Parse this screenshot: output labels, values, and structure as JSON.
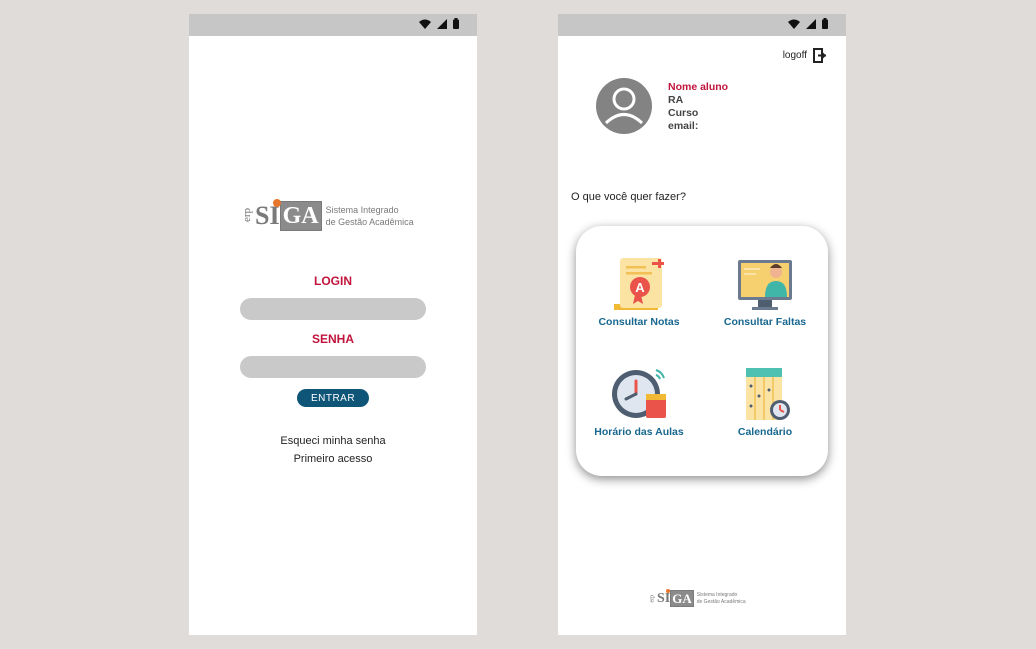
{
  "login_screen": {
    "logo": {
      "erp": "erp",
      "si": "SI",
      "ga": "GA",
      "tagline_line1": "Sistema Integrado",
      "tagline_line2": "de Gestão Acadêmica"
    },
    "login_label": "LOGIN",
    "login_value": "",
    "senha_label": "SENHA",
    "senha_value": "",
    "entrar_label": "ENTRAR",
    "forgot_password": "Esqueci minha senha",
    "first_access": "Primeiro acesso"
  },
  "home_screen": {
    "logoff_label": "logoff",
    "profile": {
      "name": "Nome aluno",
      "ra": "RA",
      "curso": "Curso",
      "email": "email:"
    },
    "question": "O que você quer fazer?",
    "menu": [
      {
        "label": "Consultar Notas",
        "icon": "grades-icon"
      },
      {
        "label": "Consultar Faltas",
        "icon": "attendance-icon"
      },
      {
        "label": "Horário das Aulas",
        "icon": "schedule-icon"
      },
      {
        "label": "Calendário",
        "icon": "calendar-icon"
      }
    ],
    "footer_logo": {
      "erp": "erp",
      "si": "SI",
      "ga": "GA",
      "tagline_line1": "Sistema Integrado",
      "tagline_line2": "de Gestão Acadêmica"
    }
  },
  "colors": {
    "background": "#e0dcda",
    "status_bar": "#c6c6c6",
    "accent_red": "#c0143c",
    "button_blue": "#0e5577",
    "menu_label_blue": "#17678f",
    "logo_orange": "#e8772e"
  }
}
